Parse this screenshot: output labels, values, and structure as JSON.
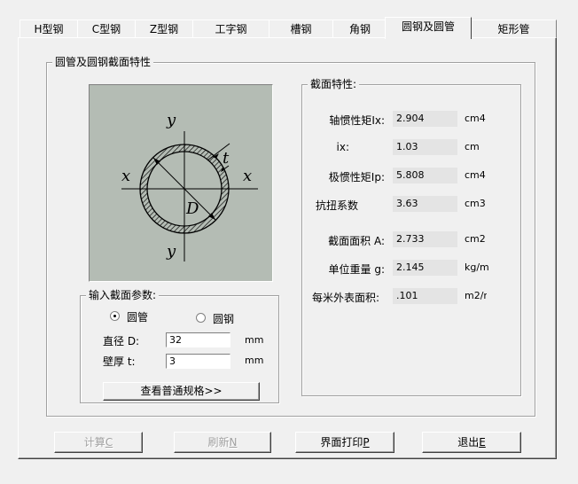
{
  "tabs": [
    "H型钢",
    "C型钢",
    "Z型钢",
    "工字钢",
    "槽钢",
    "角钢",
    "圆钢及圆管",
    "矩形管"
  ],
  "active_tab": "圆钢及圆管",
  "main_group_title": "圆管及圆钢截面特性",
  "figure_labels": {
    "y_top": "y",
    "y_bottom": "y",
    "x_left": "x",
    "x_right": "x",
    "t": "t",
    "D": "D"
  },
  "input_group": {
    "title": "输入截面参数:",
    "radio_pipe": "圆管",
    "radio_round": "圆钢",
    "selected": "圆管",
    "diameter_label": "直径 D:",
    "diameter_value": "32",
    "diameter_unit": "mm",
    "thickness_label": "壁厚 t:",
    "thickness_value": "3",
    "thickness_unit": "mm",
    "spec_button": "查看普通规格>>"
  },
  "props_group": {
    "title": "截面特性:",
    "rows": [
      {
        "label": "轴惯性矩Ix:",
        "value": "2.904",
        "unit": "cm4"
      },
      {
        "label": "ix:",
        "value": "1.03",
        "unit": "cm"
      },
      {
        "label": "极惯性矩Ip:",
        "value": "5.808",
        "unit": "cm4"
      },
      {
        "label": "抗扭系数",
        "value": "3.63",
        "unit": "cm3"
      },
      {
        "label": "截面面积 A:",
        "value": "2.733",
        "unit": "cm2"
      },
      {
        "label": "单位重量 g:",
        "value": "2.145",
        "unit": "kg/m"
      },
      {
        "label": "每米外表面积:",
        "value": ".101",
        "unit": "m2/m"
      }
    ]
  },
  "buttons": {
    "calc": {
      "text": "计算",
      "key": "C"
    },
    "refresh": {
      "text": "刷新",
      "key": "N"
    },
    "print": {
      "text": "界面打印",
      "key": "P"
    },
    "exit": {
      "text": "退出",
      "key": "E"
    }
  }
}
